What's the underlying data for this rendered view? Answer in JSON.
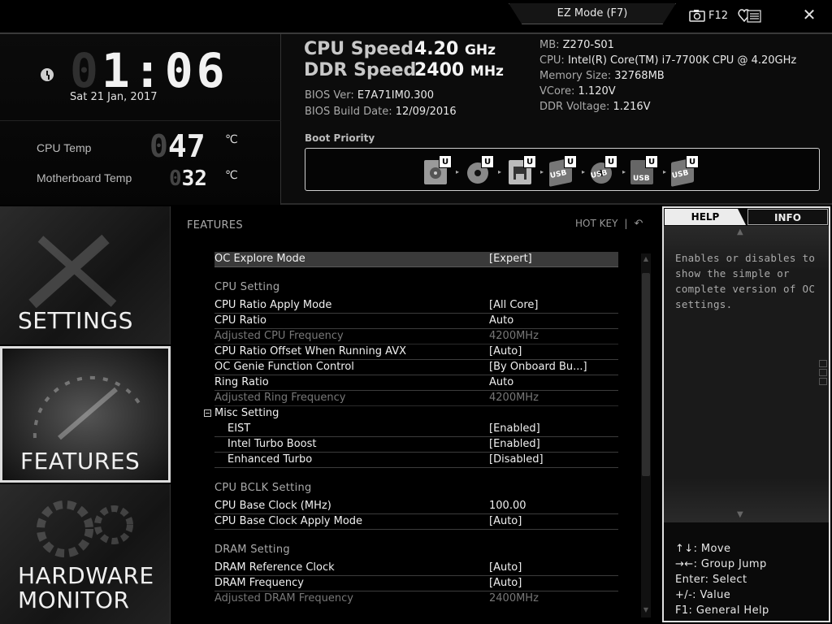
{
  "topbar": {
    "ez_mode_label": "EZ Mode (F7)",
    "screenshot_key": "F12",
    "close_label": "✕"
  },
  "clock": {
    "time_dim": "0",
    "time_hours_lit": "1",
    "time_rest": ":06",
    "date": "Sat  21 Jan, 2017"
  },
  "temps": {
    "cpu_label": "CPU Temp",
    "cpu_dim": "0",
    "cpu_value": "47",
    "mb_label": "Motherboard Temp",
    "mb_dim": "0",
    "mb_value": "32",
    "unit": "℃"
  },
  "speeds": {
    "cpu_label": "CPU Speed",
    "cpu_value": "4.20",
    "cpu_unit": "GHz",
    "ddr_label": "DDR Speed",
    "ddr_value": "2400",
    "ddr_unit": "MHz"
  },
  "bios": {
    "ver_label": "BIOS Ver:",
    "ver_value": "E7A71IM0.300",
    "date_label": "BIOS Build Date:",
    "date_value": "12/09/2016"
  },
  "system": {
    "mb_label": "MB:",
    "mb_value": "Z270-S01",
    "cpu_label": "CPU:",
    "cpu_value": "Intel(R) Core(TM) i7-7700K CPU @ 4.20GHz",
    "mem_label": "Memory Size:",
    "mem_value": "32768MB",
    "vcore_label": "VCore:",
    "vcore_value": "1.120V",
    "ddrv_label": "DDR Voltage:",
    "ddrv_value": "1.216V"
  },
  "boot": {
    "label": "Boot Priority",
    "badge": "U",
    "usb_text": "USB"
  },
  "nav": {
    "settings": "SETTINGS",
    "features": "FEATURES",
    "hw_line1": "HARDWARE",
    "hw_line2": "MONITOR"
  },
  "main": {
    "title": "FEATURES",
    "hotkey": "HOT KEY",
    "hotkey_sep": "|",
    "back_icon": "↶",
    "oc_explore": {
      "name": "OC Explore Mode",
      "value": "[Expert]"
    },
    "cpu_group": "CPU  Setting",
    "cpu_rows": [
      {
        "name": "CPU Ratio Apply Mode",
        "value": "[All Core]"
      },
      {
        "name": "CPU Ratio",
        "value": "Auto"
      },
      {
        "name": "Adjusted CPU Frequency",
        "value": "4200MHz"
      },
      {
        "name": "CPU Ratio Offset When Running AVX",
        "value": "[Auto]"
      },
      {
        "name": "OC Genie Function Control",
        "value": "[By Onboard Bu...]"
      },
      {
        "name": "Ring Ratio",
        "value": "Auto"
      },
      {
        "name": "Adjusted Ring Frequency",
        "value": "4200MHz"
      }
    ],
    "misc_group": "Misc Setting",
    "misc_rows": [
      {
        "name": "EIST",
        "value": "[Enabled]"
      },
      {
        "name": "Intel Turbo Boost",
        "value": "[Enabled]"
      },
      {
        "name": "Enhanced Turbo",
        "value": "[Disabled]"
      }
    ],
    "bclk_group": "CPU  BCLK  Setting",
    "bclk_rows": [
      {
        "name": "CPU Base Clock (MHz)",
        "value": "100.00"
      },
      {
        "name": "CPU Base Clock Apply Mode",
        "value": "[Auto]"
      }
    ],
    "dram_group": "DRAM  Setting",
    "dram_rows": [
      {
        "name": "DRAM Reference Clock",
        "value": "[Auto]"
      },
      {
        "name": "DRAM Frequency",
        "value": "[Auto]"
      },
      {
        "name": "Adjusted DRAM Frequency",
        "value": "2400MHz"
      }
    ]
  },
  "help": {
    "tab_help": "HELP",
    "tab_info": "INFO",
    "text": "Enables or disables to show the simple or complete version of OC settings.",
    "keys": [
      "↑↓: Move",
      "→←: Group Jump",
      "Enter: Select",
      "+/-: Value",
      "F1: General Help"
    ]
  }
}
